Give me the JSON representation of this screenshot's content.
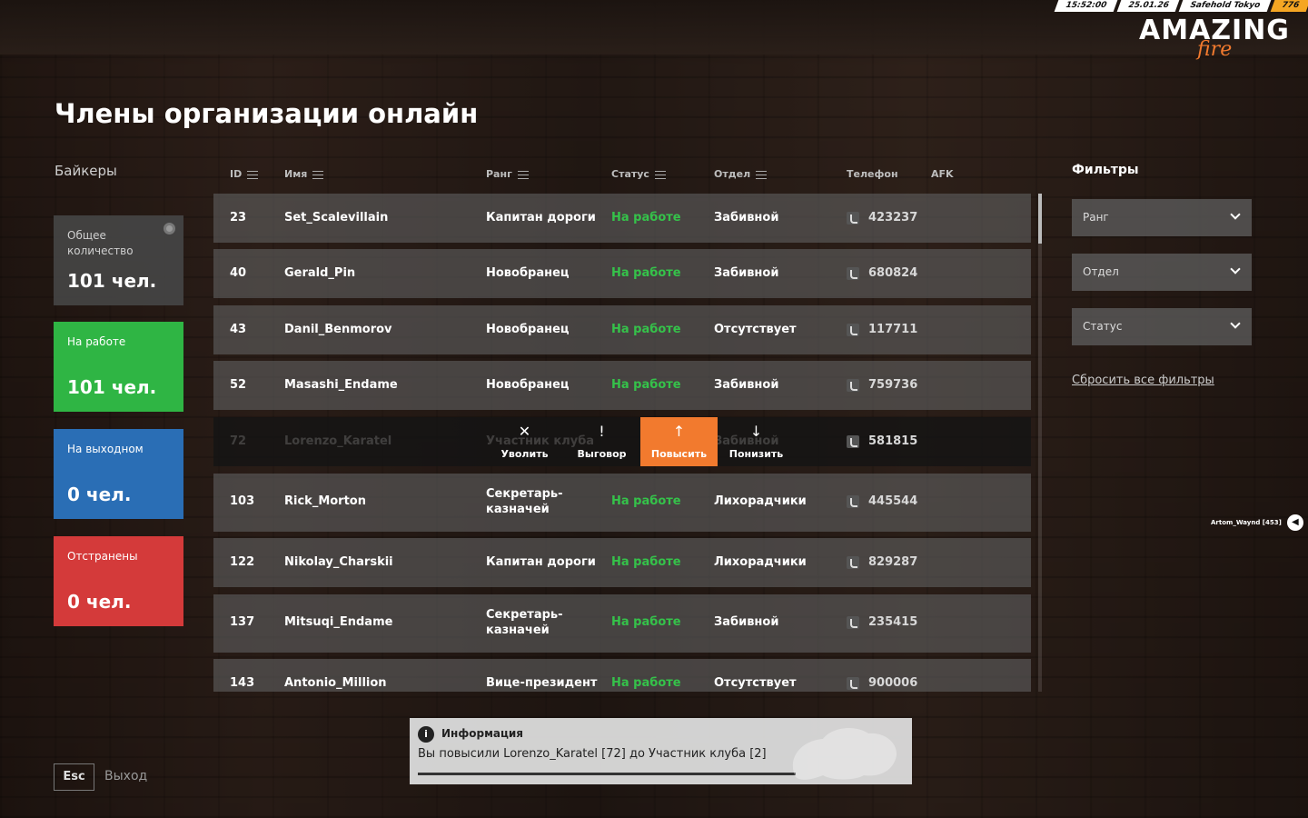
{
  "hud": {
    "time": "15:52:00",
    "date": "25.01.26",
    "server": "Safehold Tokyo",
    "money": "776"
  },
  "logo": {
    "main": "AMAZING",
    "sub": "fire"
  },
  "page_title": "Члены организации онлайн",
  "org_name": "Байкеры",
  "stats": [
    {
      "label": "Общее количество",
      "value": "101 чел."
    },
    {
      "label": "На работе",
      "value": "101 чел."
    },
    {
      "label": "На выходном",
      "value": "0 чел."
    },
    {
      "label": "Отстранены",
      "value": "0 чел."
    }
  ],
  "columns": {
    "id": "ID",
    "name": "Имя",
    "rank": "Ранг",
    "status": "Статус",
    "dept": "Отдел",
    "phone": "Телефон",
    "afk": "AFK"
  },
  "members": [
    {
      "id": "23",
      "name": "Set_Scalevillain",
      "rank": "Капитан дороги",
      "status": "На работе",
      "dept": "Забивной",
      "phone": "423237"
    },
    {
      "id": "40",
      "name": "Gerald_Pin",
      "rank": "Новобранец",
      "status": "На работе",
      "dept": "Забивной",
      "phone": "680824"
    },
    {
      "id": "43",
      "name": "Danil_Benmorov",
      "rank": "Новобранец",
      "status": "На работе",
      "dept": "Отсутствует",
      "phone": "117711"
    },
    {
      "id": "52",
      "name": "Masashi_Endame",
      "rank": "Новобранец",
      "status": "На работе",
      "dept": "Забивной",
      "phone": "759736"
    },
    {
      "id": "72",
      "name": "Lorenzo_Karatel",
      "rank": "Участник клуба",
      "status": "",
      "dept": "Забивной",
      "phone": "581815"
    },
    {
      "id": "103",
      "name": "Rick_Morton",
      "rank": "Секретарь-казначей",
      "status": "На работе",
      "dept": "Лихорадчики",
      "phone": "445544"
    },
    {
      "id": "122",
      "name": "Nikolay_Charskii",
      "rank": "Капитан дороги",
      "status": "На работе",
      "dept": "Лихорадчики",
      "phone": "829287"
    },
    {
      "id": "137",
      "name": "Mitsuqi_Endame",
      "rank": "Секретарь-казначей",
      "status": "На работе",
      "dept": "Забивной",
      "phone": "235415"
    },
    {
      "id": "143",
      "name": "Antonio_Million",
      "rank": "Вице-президент",
      "status": "На работе",
      "dept": "Отсутствует",
      "phone": "900006"
    }
  ],
  "actions": [
    {
      "label": "Уволить",
      "icon": "close-icon",
      "glyph": "✕"
    },
    {
      "label": "Выговор",
      "icon": "exclamation-icon",
      "glyph": "!"
    },
    {
      "label": "Повысить",
      "icon": "arrow-up-icon",
      "glyph": "↑"
    },
    {
      "label": "Понизить",
      "icon": "arrow-down-icon",
      "glyph": "↓"
    }
  ],
  "filters": {
    "title": "Фильтры",
    "rank": "Ранг",
    "dept": "Отдел",
    "status": "Статус",
    "reset": "Сбросить все фильтры"
  },
  "voice": {
    "user": "Artom_Waynd [453]"
  },
  "footer": {
    "key": "Esc",
    "label": "Выход"
  },
  "toast": {
    "title": "Информация",
    "icon": "i",
    "message": "Вы повысили Lorenzo_Karatel [72] до Участник клуба [2]"
  },
  "colors": {
    "accent": "#f27a2e",
    "working": "#2fb544",
    "weekend": "#2a6eb5",
    "suspended": "#d43a3a"
  }
}
